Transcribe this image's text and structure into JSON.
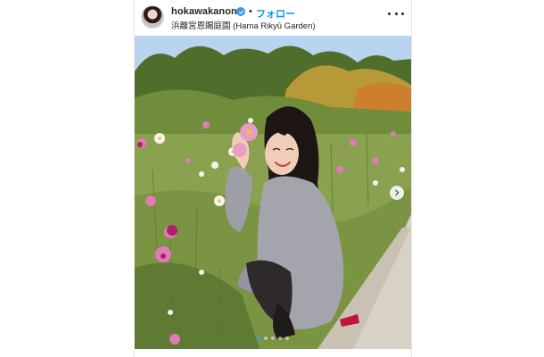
{
  "post": {
    "username": "hokawakanonn",
    "separator": "•",
    "follow_label": "フォロー",
    "location": "浜離宮恩賜庭園 (Hama Rikyū Garden)",
    "verified_icon": "verified-badge-icon",
    "more_icon": "more-options-icon",
    "next_icon": "chevron-right-icon",
    "carousel": {
      "slide_count": 5,
      "active_index": 0
    }
  },
  "colors": {
    "follow": "#0095f6",
    "verified": "#3897f0",
    "text": "#262626"
  }
}
